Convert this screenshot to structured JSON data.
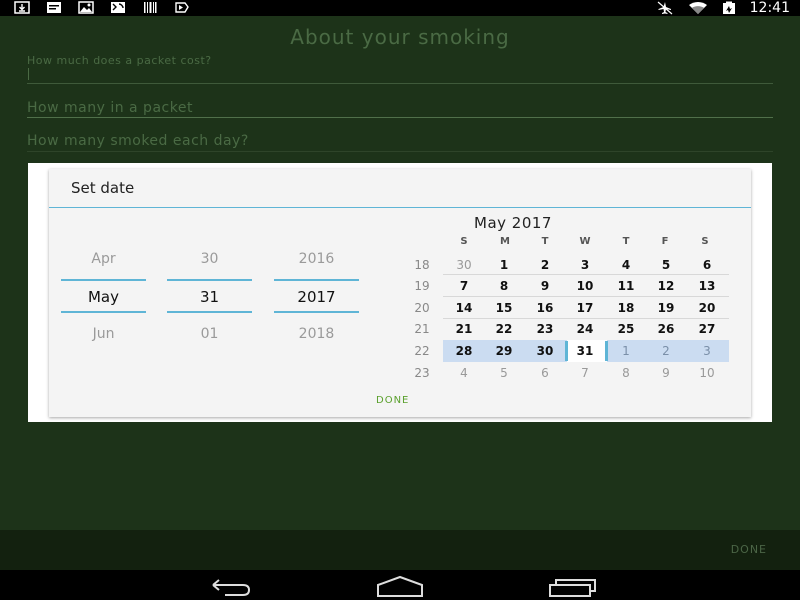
{
  "status_bar": {
    "time": "12:41",
    "left_icons": [
      "download-icon",
      "message-icon",
      "photo-icon",
      "maps-icon",
      "barcode-icon",
      "play-store-icon"
    ],
    "right_icons": [
      "airplane-off-icon",
      "wifi-icon",
      "battery-icon"
    ]
  },
  "app": {
    "title": "About your smoking",
    "fields": [
      {
        "hint": "How much does a packet cost?"
      },
      {
        "hint": "How many in a packet"
      },
      {
        "hint": "How many smoked each day?"
      }
    ],
    "done_label": "DONE"
  },
  "dialog": {
    "title": "Set date",
    "spinners": {
      "month": {
        "prev": "Apr",
        "current": "May",
        "next": "Jun"
      },
      "day": {
        "prev": "30",
        "current": "31",
        "next": "01"
      },
      "year": {
        "prev": "2016",
        "current": "2017",
        "next": "2018"
      }
    },
    "calendar": {
      "month_title": "May 2017",
      "weekdays": [
        "S",
        "M",
        "T",
        "W",
        "T",
        "F",
        "S"
      ],
      "weeks": [
        {
          "num": "18",
          "days": [
            "30",
            "1",
            "2",
            "3",
            "4",
            "5",
            "6"
          ]
        },
        {
          "num": "19",
          "days": [
            "7",
            "8",
            "9",
            "10",
            "11",
            "12",
            "13"
          ]
        },
        {
          "num": "20",
          "days": [
            "14",
            "15",
            "16",
            "17",
            "18",
            "19",
            "20"
          ]
        },
        {
          "num": "21",
          "days": [
            "21",
            "22",
            "23",
            "24",
            "25",
            "26",
            "27"
          ]
        },
        {
          "num": "22",
          "days": [
            "28",
            "29",
            "30",
            "31",
            "1",
            "2",
            "3"
          ]
        },
        {
          "num": "23",
          "days": [
            "4",
            "5",
            "6",
            "7",
            "8",
            "9",
            "10"
          ]
        }
      ],
      "selected_day": "31"
    },
    "done_label": "DONE"
  },
  "nav_bar": {
    "buttons": [
      "back-icon",
      "home-icon",
      "recents-icon"
    ]
  },
  "colors": {
    "accent": "#5fb5d6",
    "app_background": "#1d3319",
    "done_green": "#5aa02c",
    "week_highlight": "#cbdcf1"
  }
}
